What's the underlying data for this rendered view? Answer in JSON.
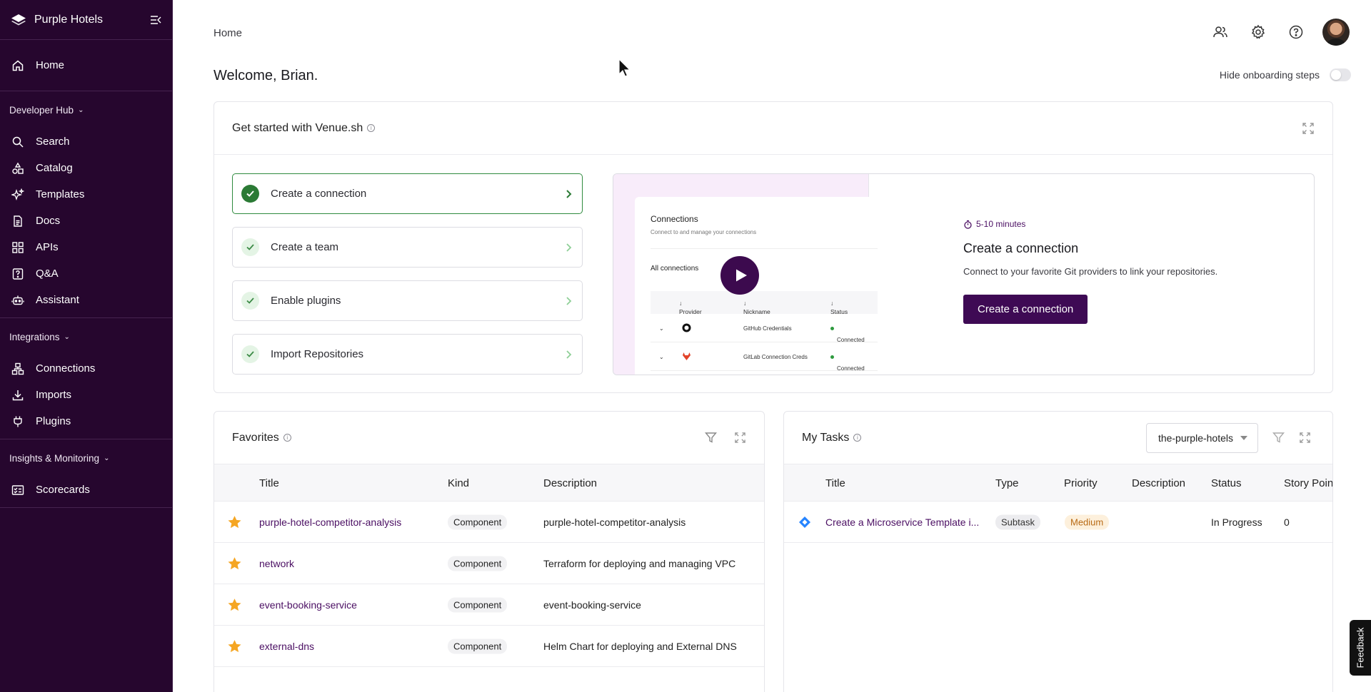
{
  "sidebar": {
    "brand": "Purple Hotels",
    "home": "Home",
    "sections": [
      {
        "title": "Developer Hub",
        "items": [
          "Search",
          "Catalog",
          "Templates",
          "Docs",
          "APIs",
          "Q&A",
          "Assistant"
        ]
      },
      {
        "title": "Integrations",
        "items": [
          "Connections",
          "Imports",
          "Plugins"
        ]
      },
      {
        "title": "Insights & Monitoring",
        "items": [
          "Scorecards"
        ]
      }
    ]
  },
  "header": {
    "breadcrumb": "Home",
    "welcome": "Welcome, Brian.",
    "hide_onboarding_label": "Hide onboarding steps",
    "hide_onboarding_on": false
  },
  "get_started": {
    "title": "Get started with Venue.sh",
    "steps": [
      "Create a connection",
      "Create a team",
      "Enable plugins",
      "Import Repositories"
    ],
    "video": {
      "title": "Connections",
      "subtitle": "Connect to and manage your connections",
      "section": "All connections",
      "columns": [
        "Provider",
        "Nickname",
        "Status"
      ],
      "rows": [
        {
          "nickname": "GitHub Credentials",
          "status": "Connected"
        },
        {
          "nickname": "GitLab Connection Creds",
          "status": "Connected"
        }
      ]
    },
    "duration": "5-10 minutes",
    "detail_title": "Create a connection",
    "detail_desc": "Connect to your favorite Git providers to link your repositories.",
    "cta": "Create a connection"
  },
  "favorites": {
    "title": "Favorites",
    "columns": [
      "Title",
      "Kind",
      "Description"
    ],
    "rows": [
      {
        "title": "purple-hotel-competitor-analysis",
        "kind": "Component",
        "description": "purple-hotel-competitor-analysis"
      },
      {
        "title": "network",
        "kind": "Component",
        "description": "Terraform for deploying and managing VPC"
      },
      {
        "title": "event-booking-service",
        "kind": "Component",
        "description": "event-booking-service"
      },
      {
        "title": "external-dns",
        "kind": "Component",
        "description": "Helm Chart for deploying and External DNS"
      }
    ]
  },
  "tasks": {
    "title": "My Tasks",
    "project_select": "the-purple-hotels",
    "columns": [
      "Title",
      "Type",
      "Priority",
      "Description",
      "Status",
      "Story Poin"
    ],
    "rows": [
      {
        "title": "Create a Microservice Template i...",
        "type": "Subtask",
        "priority": "Medium",
        "description": "",
        "status": "In Progress",
        "points": "0"
      }
    ]
  },
  "feedback": "Feedback",
  "colors": {
    "sidebar": "#26062e",
    "primary": "#3e0a54",
    "success": "#2b7a35",
    "star": "#f5a623"
  }
}
